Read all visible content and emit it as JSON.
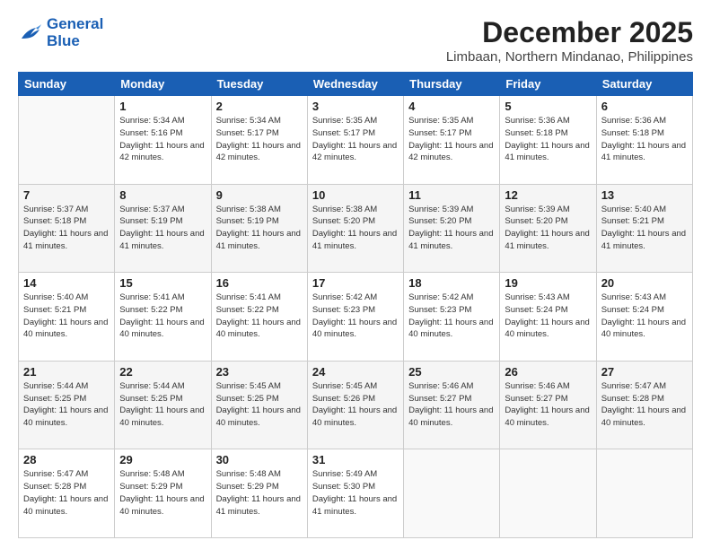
{
  "logo": {
    "line1": "General",
    "line2": "Blue"
  },
  "header": {
    "month": "December 2025",
    "location": "Limbaan, Northern Mindanao, Philippines"
  },
  "weekdays": [
    "Sunday",
    "Monday",
    "Tuesday",
    "Wednesday",
    "Thursday",
    "Friday",
    "Saturday"
  ],
  "weeks": [
    [
      {
        "day": "",
        "sunrise": "",
        "sunset": "",
        "daylight": ""
      },
      {
        "day": "1",
        "sunrise": "Sunrise: 5:34 AM",
        "sunset": "Sunset: 5:16 PM",
        "daylight": "Daylight: 11 hours and 42 minutes."
      },
      {
        "day": "2",
        "sunrise": "Sunrise: 5:34 AM",
        "sunset": "Sunset: 5:17 PM",
        "daylight": "Daylight: 11 hours and 42 minutes."
      },
      {
        "day": "3",
        "sunrise": "Sunrise: 5:35 AM",
        "sunset": "Sunset: 5:17 PM",
        "daylight": "Daylight: 11 hours and 42 minutes."
      },
      {
        "day": "4",
        "sunrise": "Sunrise: 5:35 AM",
        "sunset": "Sunset: 5:17 PM",
        "daylight": "Daylight: 11 hours and 42 minutes."
      },
      {
        "day": "5",
        "sunrise": "Sunrise: 5:36 AM",
        "sunset": "Sunset: 5:18 PM",
        "daylight": "Daylight: 11 hours and 41 minutes."
      },
      {
        "day": "6",
        "sunrise": "Sunrise: 5:36 AM",
        "sunset": "Sunset: 5:18 PM",
        "daylight": "Daylight: 11 hours and 41 minutes."
      }
    ],
    [
      {
        "day": "7",
        "sunrise": "Sunrise: 5:37 AM",
        "sunset": "Sunset: 5:18 PM",
        "daylight": "Daylight: 11 hours and 41 minutes."
      },
      {
        "day": "8",
        "sunrise": "Sunrise: 5:37 AM",
        "sunset": "Sunset: 5:19 PM",
        "daylight": "Daylight: 11 hours and 41 minutes."
      },
      {
        "day": "9",
        "sunrise": "Sunrise: 5:38 AM",
        "sunset": "Sunset: 5:19 PM",
        "daylight": "Daylight: 11 hours and 41 minutes."
      },
      {
        "day": "10",
        "sunrise": "Sunrise: 5:38 AM",
        "sunset": "Sunset: 5:20 PM",
        "daylight": "Daylight: 11 hours and 41 minutes."
      },
      {
        "day": "11",
        "sunrise": "Sunrise: 5:39 AM",
        "sunset": "Sunset: 5:20 PM",
        "daylight": "Daylight: 11 hours and 41 minutes."
      },
      {
        "day": "12",
        "sunrise": "Sunrise: 5:39 AM",
        "sunset": "Sunset: 5:20 PM",
        "daylight": "Daylight: 11 hours and 41 minutes."
      },
      {
        "day": "13",
        "sunrise": "Sunrise: 5:40 AM",
        "sunset": "Sunset: 5:21 PM",
        "daylight": "Daylight: 11 hours and 41 minutes."
      }
    ],
    [
      {
        "day": "14",
        "sunrise": "Sunrise: 5:40 AM",
        "sunset": "Sunset: 5:21 PM",
        "daylight": "Daylight: 11 hours and 40 minutes."
      },
      {
        "day": "15",
        "sunrise": "Sunrise: 5:41 AM",
        "sunset": "Sunset: 5:22 PM",
        "daylight": "Daylight: 11 hours and 40 minutes."
      },
      {
        "day": "16",
        "sunrise": "Sunrise: 5:41 AM",
        "sunset": "Sunset: 5:22 PM",
        "daylight": "Daylight: 11 hours and 40 minutes."
      },
      {
        "day": "17",
        "sunrise": "Sunrise: 5:42 AM",
        "sunset": "Sunset: 5:23 PM",
        "daylight": "Daylight: 11 hours and 40 minutes."
      },
      {
        "day": "18",
        "sunrise": "Sunrise: 5:42 AM",
        "sunset": "Sunset: 5:23 PM",
        "daylight": "Daylight: 11 hours and 40 minutes."
      },
      {
        "day": "19",
        "sunrise": "Sunrise: 5:43 AM",
        "sunset": "Sunset: 5:24 PM",
        "daylight": "Daylight: 11 hours and 40 minutes."
      },
      {
        "day": "20",
        "sunrise": "Sunrise: 5:43 AM",
        "sunset": "Sunset: 5:24 PM",
        "daylight": "Daylight: 11 hours and 40 minutes."
      }
    ],
    [
      {
        "day": "21",
        "sunrise": "Sunrise: 5:44 AM",
        "sunset": "Sunset: 5:25 PM",
        "daylight": "Daylight: 11 hours and 40 minutes."
      },
      {
        "day": "22",
        "sunrise": "Sunrise: 5:44 AM",
        "sunset": "Sunset: 5:25 PM",
        "daylight": "Daylight: 11 hours and 40 minutes."
      },
      {
        "day": "23",
        "sunrise": "Sunrise: 5:45 AM",
        "sunset": "Sunset: 5:25 PM",
        "daylight": "Daylight: 11 hours and 40 minutes."
      },
      {
        "day": "24",
        "sunrise": "Sunrise: 5:45 AM",
        "sunset": "Sunset: 5:26 PM",
        "daylight": "Daylight: 11 hours and 40 minutes."
      },
      {
        "day": "25",
        "sunrise": "Sunrise: 5:46 AM",
        "sunset": "Sunset: 5:27 PM",
        "daylight": "Daylight: 11 hours and 40 minutes."
      },
      {
        "day": "26",
        "sunrise": "Sunrise: 5:46 AM",
        "sunset": "Sunset: 5:27 PM",
        "daylight": "Daylight: 11 hours and 40 minutes."
      },
      {
        "day": "27",
        "sunrise": "Sunrise: 5:47 AM",
        "sunset": "Sunset: 5:28 PM",
        "daylight": "Daylight: 11 hours and 40 minutes."
      }
    ],
    [
      {
        "day": "28",
        "sunrise": "Sunrise: 5:47 AM",
        "sunset": "Sunset: 5:28 PM",
        "daylight": "Daylight: 11 hours and 40 minutes."
      },
      {
        "day": "29",
        "sunrise": "Sunrise: 5:48 AM",
        "sunset": "Sunset: 5:29 PM",
        "daylight": "Daylight: 11 hours and 40 minutes."
      },
      {
        "day": "30",
        "sunrise": "Sunrise: 5:48 AM",
        "sunset": "Sunset: 5:29 PM",
        "daylight": "Daylight: 11 hours and 41 minutes."
      },
      {
        "day": "31",
        "sunrise": "Sunrise: 5:49 AM",
        "sunset": "Sunset: 5:30 PM",
        "daylight": "Daylight: 11 hours and 41 minutes."
      },
      {
        "day": "",
        "sunrise": "",
        "sunset": "",
        "daylight": ""
      },
      {
        "day": "",
        "sunrise": "",
        "sunset": "",
        "daylight": ""
      },
      {
        "day": "",
        "sunrise": "",
        "sunset": "",
        "daylight": ""
      }
    ]
  ]
}
